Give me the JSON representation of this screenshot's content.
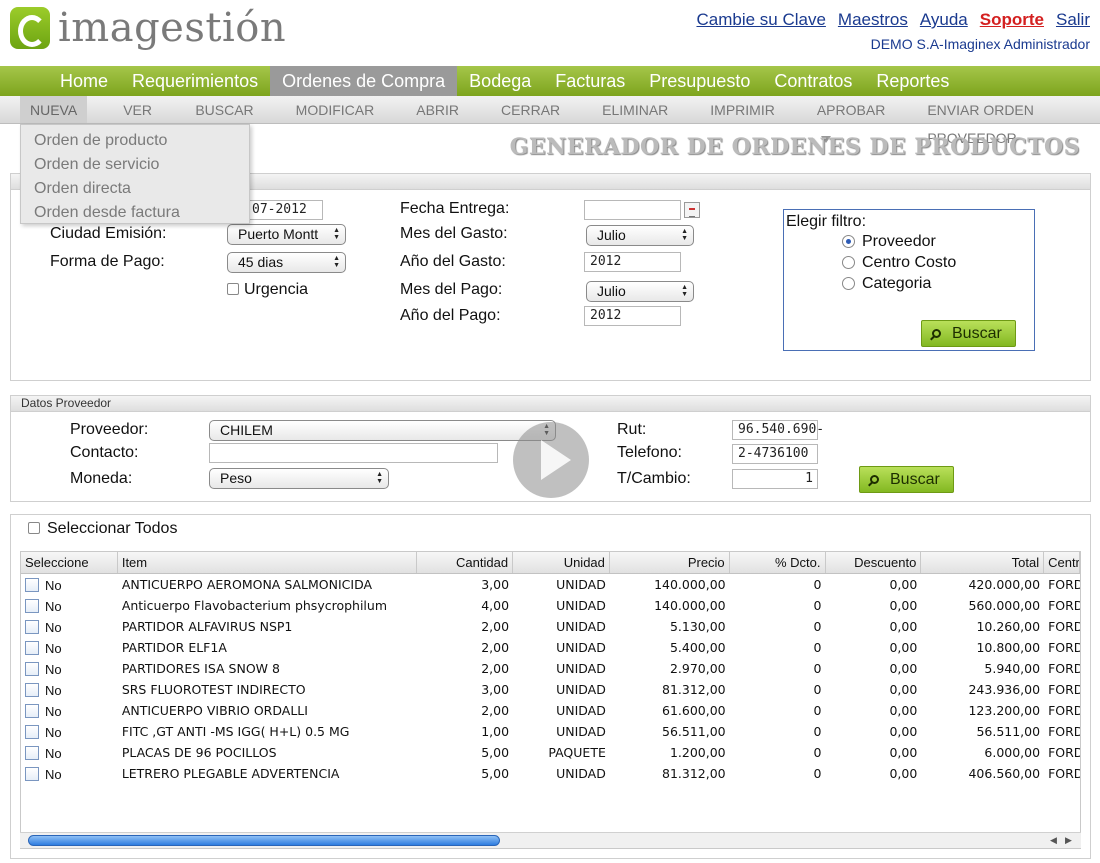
{
  "brand": {
    "name": "imagestión"
  },
  "toplinks": {
    "change_password": "Cambie su Clave",
    "masters": "Maestros",
    "help": "Ayuda",
    "support": "Soporte",
    "logout": "Salir",
    "user": "DEMO S.A-Imaginex Administrador"
  },
  "colors": {
    "nav_green": "#8db82d",
    "link_blue": "#1a3a8f",
    "support_red": "#d42020",
    "active_tab": "#9a9a9a"
  },
  "mainnav": [
    "Home",
    "Requerimientos",
    "Ordenes de Compra",
    "Bodega",
    "Facturas",
    "Presupuesto",
    "Contratos",
    "Reportes"
  ],
  "mainnav_active": "Ordenes de Compra",
  "subnav": [
    "NUEVA",
    "VER",
    "BUSCAR",
    "MODIFICAR",
    "ABRIR",
    "CERRAR",
    "ELIMINAR",
    "IMPRIMIR",
    "APROBAR",
    "ENVIAR ORDEN PROVEEDOR"
  ],
  "dropdown": [
    "Orden de producto",
    "Orden de servicio",
    "Orden directa",
    "Orden desde factura"
  ],
  "page_title": "GENERADOR DE ORDENES DE PRODUCTOS",
  "form": {
    "fecha_emision_value": "07-2012",
    "ciudad_label": "Ciudad Emisión:",
    "ciudad_value": "Puerto Montt",
    "pago_label": "Forma de Pago:",
    "pago_value": "45 dias",
    "urgencia_label": "Urgencia",
    "fecha_entrega_label": "Fecha Entrega:",
    "fecha_entrega_value": "",
    "mes_gasto_label": "Mes del Gasto:",
    "mes_gasto_value": "Julio",
    "anio_gasto_label": "Año del Gasto:",
    "anio_gasto_value": "2012",
    "mes_pago_label": "Mes del Pago:",
    "mes_pago_value": "Julio",
    "anio_pago_label": "Año del Pago:",
    "anio_pago_value": "2012"
  },
  "filter": {
    "title": "Elegir filtro:",
    "options": [
      "Proveedor",
      "Centro Costo",
      "Categoria"
    ],
    "selected": "Proveedor",
    "button": "Buscar"
  },
  "proveedor": {
    "section": "Datos Proveedor",
    "proveedor_label": "Proveedor:",
    "proveedor_value": "CHILEM",
    "contacto_label": "Contacto:",
    "contacto_value": "",
    "moneda_label": "Moneda:",
    "moneda_value": "Peso",
    "rut_label": "Rut:",
    "rut_value": "96.540.690-",
    "telefono_label": "Telefono:",
    "telefono_value": "2-4736100",
    "tcambio_label": "T/Cambio:",
    "tcambio_value": "1",
    "button": "Buscar"
  },
  "select_all": "Seleccionar Todos",
  "table": {
    "columns": [
      "Seleccione",
      "Item",
      "Cantidad",
      "Unidad",
      "Precio",
      "% Dcto.",
      "Descuento",
      "Total",
      "Centro"
    ],
    "rows": [
      {
        "sel": "No",
        "item": "ANTICUERPO AEROMONA SALMONICIDA",
        "cantidad": "3,00",
        "unidad": "UNIDAD",
        "precio": "140.000,00",
        "dcto": "0",
        "descuento": "0,00",
        "total": "420.000,00",
        "centro": "FORD"
      },
      {
        "sel": "No",
        "item": "Anticuerpo Flavobacterium phsycrophilum",
        "cantidad": "4,00",
        "unidad": "UNIDAD",
        "precio": "140.000,00",
        "dcto": "0",
        "descuento": "0,00",
        "total": "560.000,00",
        "centro": "FORD"
      },
      {
        "sel": "No",
        "item": "PARTIDOR ALFAVIRUS NSP1",
        "cantidad": "2,00",
        "unidad": "UNIDAD",
        "precio": "5.130,00",
        "dcto": "0",
        "descuento": "0,00",
        "total": "10.260,00",
        "centro": "FORD"
      },
      {
        "sel": "No",
        "item": "PARTIDOR ELF1A",
        "cantidad": "2,00",
        "unidad": "UNIDAD",
        "precio": "5.400,00",
        "dcto": "0",
        "descuento": "0,00",
        "total": "10.800,00",
        "centro": "FORD"
      },
      {
        "sel": "No",
        "item": "PARTIDORES ISA SNOW 8",
        "cantidad": "2,00",
        "unidad": "UNIDAD",
        "precio": "2.970,00",
        "dcto": "0",
        "descuento": "0,00",
        "total": "5.940,00",
        "centro": "FORD"
      },
      {
        "sel": "No",
        "item": "SRS FLUOROTEST INDIRECTO",
        "cantidad": "3,00",
        "unidad": "UNIDAD",
        "precio": "81.312,00",
        "dcto": "0",
        "descuento": "0,00",
        "total": "243.936,00",
        "centro": "FORD"
      },
      {
        "sel": "No",
        "item": "ANTICUERPO VIBRIO ORDALLI",
        "cantidad": "2,00",
        "unidad": "UNIDAD",
        "precio": "61.600,00",
        "dcto": "0",
        "descuento": "0,00",
        "total": "123.200,00",
        "centro": "FORD"
      },
      {
        "sel": "No",
        "item": "FITC ,GT ANTI -MS IGG( H+L) 0.5 MG",
        "cantidad": "1,00",
        "unidad": "UNIDAD",
        "precio": "56.511,00",
        "dcto": "0",
        "descuento": "0,00",
        "total": "56.511,00",
        "centro": "FORD"
      },
      {
        "sel": "No",
        "item": "PLACAS DE 96 POCILLOS",
        "cantidad": "5,00",
        "unidad": "PAQUETE",
        "precio": "1.200,00",
        "dcto": "0",
        "descuento": "0,00",
        "total": "6.000,00",
        "centro": "FORD"
      },
      {
        "sel": "No",
        "item": "LETRERO PLEGABLE ADVERTENCIA",
        "cantidad": "5,00",
        "unidad": "UNIDAD",
        "precio": "81.312,00",
        "dcto": "0",
        "descuento": "0,00",
        "total": "406.560,00",
        "centro": "FORD"
      }
    ]
  }
}
